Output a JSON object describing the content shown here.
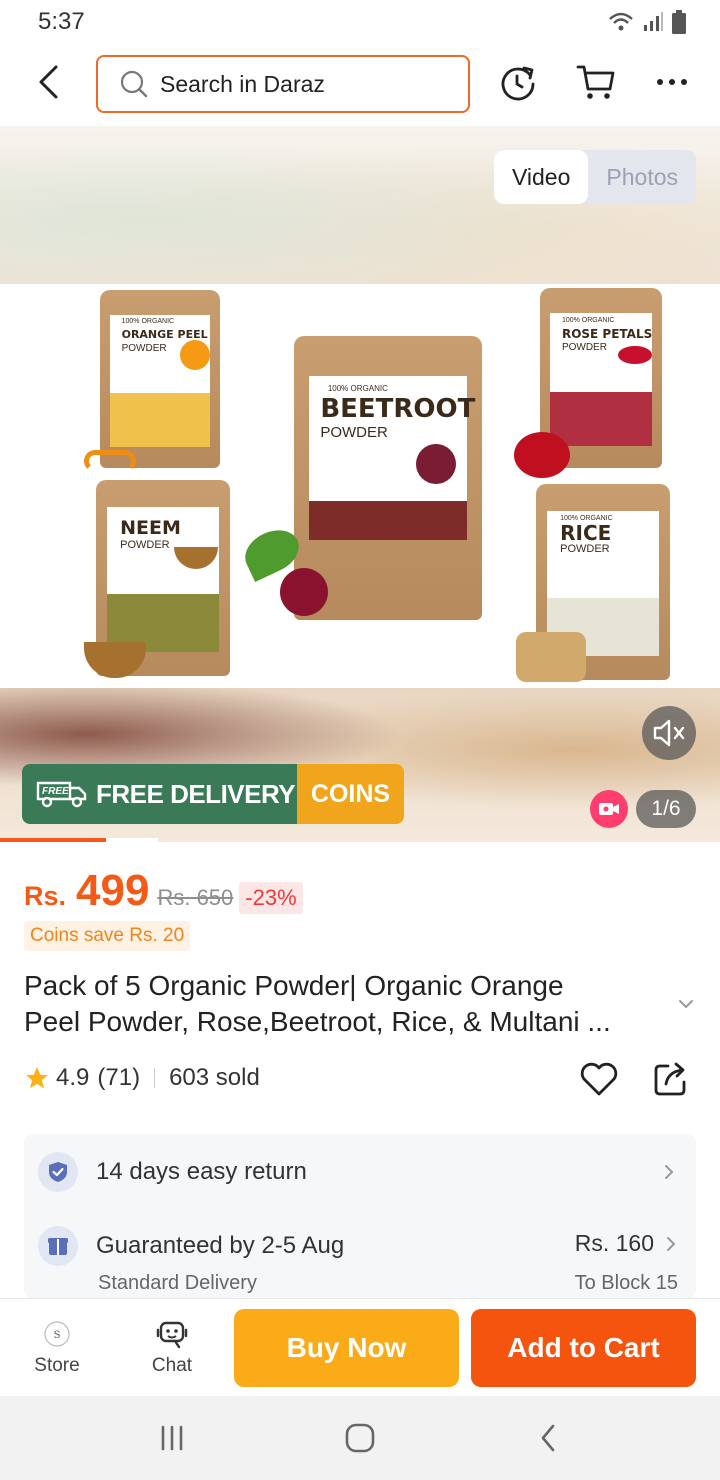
{
  "status_bar": {
    "time": "5:37"
  },
  "header": {
    "search_placeholder": "Search in Daraz"
  },
  "media": {
    "toggle": {
      "video": "Video",
      "photos": "Photos"
    },
    "banner": {
      "free_tag": "FREE",
      "free_delivery": "FREE DELIVERY",
      "coins": "COINS"
    },
    "counter": "1/6",
    "products": [
      {
        "name": "ORANGE PEEL",
        "sub": "POWDER",
        "small": "100% ORGANIC"
      },
      {
        "name": "BEETROOT",
        "sub": "POWDER",
        "small": "100% ORGANIC"
      },
      {
        "name": "ROSE PETALS",
        "sub": "POWDER",
        "small": "100% ORGANIC"
      },
      {
        "name": "NEEM",
        "sub": "POWDER",
        "small": ""
      },
      {
        "name": "RICE",
        "sub": "POWDER",
        "small": "100% ORGANIC"
      }
    ],
    "progress_fraction": 0.147
  },
  "price": {
    "currency": "Rs.",
    "current": "499",
    "original": "Rs. 650",
    "discount": "-23%",
    "coins_save": "Coins save Rs. 20"
  },
  "product": {
    "title_line1": "Pack of 5 Organic Powder| Organic Orange",
    "title_line2": "Peel Powder, Rose,Beetroot, Rice, & Multani ...",
    "rating": "4.9",
    "reviews": "(71)",
    "sold": "603 sold"
  },
  "services": {
    "return": "14 days easy return",
    "delivery": "Guaranteed by 2-5 Aug",
    "delivery_type": "Standard Delivery",
    "delivery_fee": "Rs. 160",
    "delivery_to": "To Block 15"
  },
  "bottom_bar": {
    "store": "Store",
    "chat": "Chat",
    "buy_now": "Buy Now",
    "add_to_cart": "Add to Cart"
  },
  "colors": {
    "accent": "#f35a18",
    "buy_now": "#fbab18",
    "add_to_cart": "#f4540e",
    "free_delivery_bg": "#3b7a57",
    "coins_bg": "#f0a51c"
  }
}
